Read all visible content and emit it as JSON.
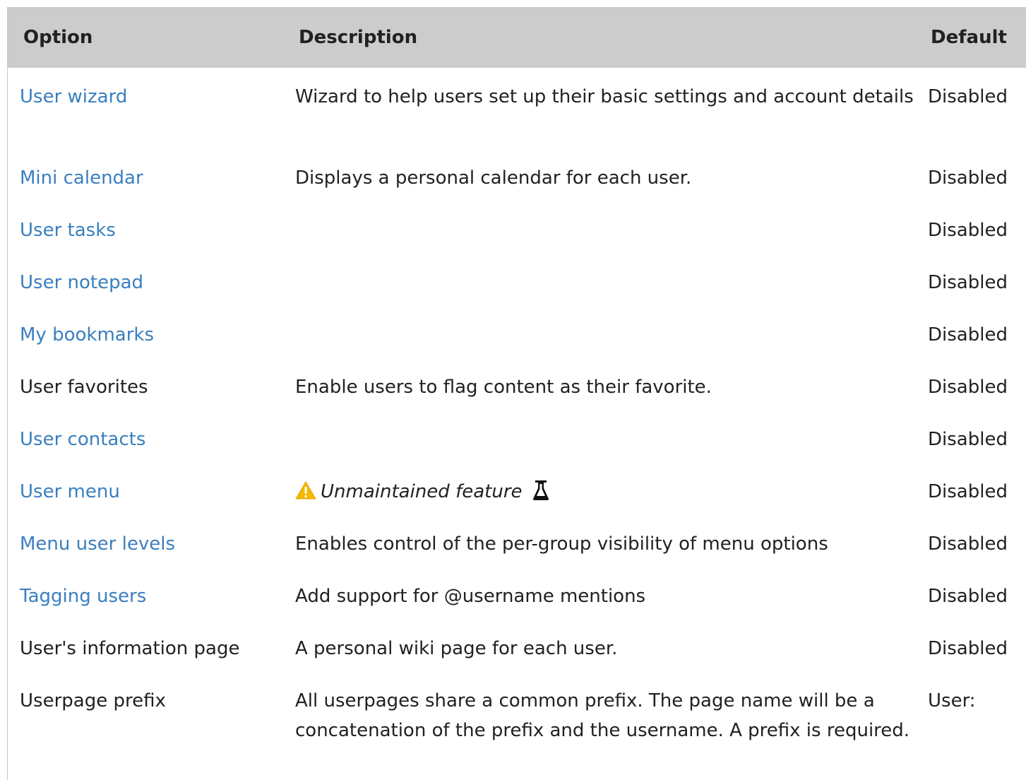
{
  "header": {
    "option": "Option",
    "description": "Description",
    "default": "Default"
  },
  "rows": [
    {
      "option": "User wizard",
      "description": "Wizard to help users set up their basic settings and account details",
      "default": "Disabled"
    },
    {
      "option": "Mini calendar",
      "description": "Displays a personal calendar for each user.",
      "default": "Disabled"
    },
    {
      "option": "User tasks",
      "description": "",
      "default": "Disabled"
    },
    {
      "option": "User notepad",
      "description": "",
      "default": "Disabled"
    },
    {
      "option": "My bookmarks",
      "description": "",
      "default": "Disabled"
    },
    {
      "option": "User favorites",
      "description": "Enable users to flag content as their favorite.",
      "default": "Disabled"
    },
    {
      "option": "User contacts",
      "description": "",
      "default": "Disabled"
    },
    {
      "option": "User menu",
      "description": "Unmaintained feature",
      "default": "Disabled"
    },
    {
      "option": "Menu user levels",
      "description": "Enables control of the per-group visibility of menu options",
      "default": "Disabled"
    },
    {
      "option": "Tagging users",
      "description": "Add support for @username mentions",
      "default": "Disabled"
    },
    {
      "option": "User's information page",
      "description": "A personal wiki page for each user.",
      "default": "Disabled"
    },
    {
      "option": "Userpage prefix",
      "description": "All userpages share a common prefix. The page name will be a concatenation of the prefix and the username. A prefix is required.",
      "default": "User:"
    }
  ],
  "colors": {
    "link": "#3a7fbf",
    "header_bg": "#cccccc",
    "warning": "#f5b800"
  },
  "icons": {
    "warning": "warning-icon",
    "experimental": "flask-icon"
  }
}
